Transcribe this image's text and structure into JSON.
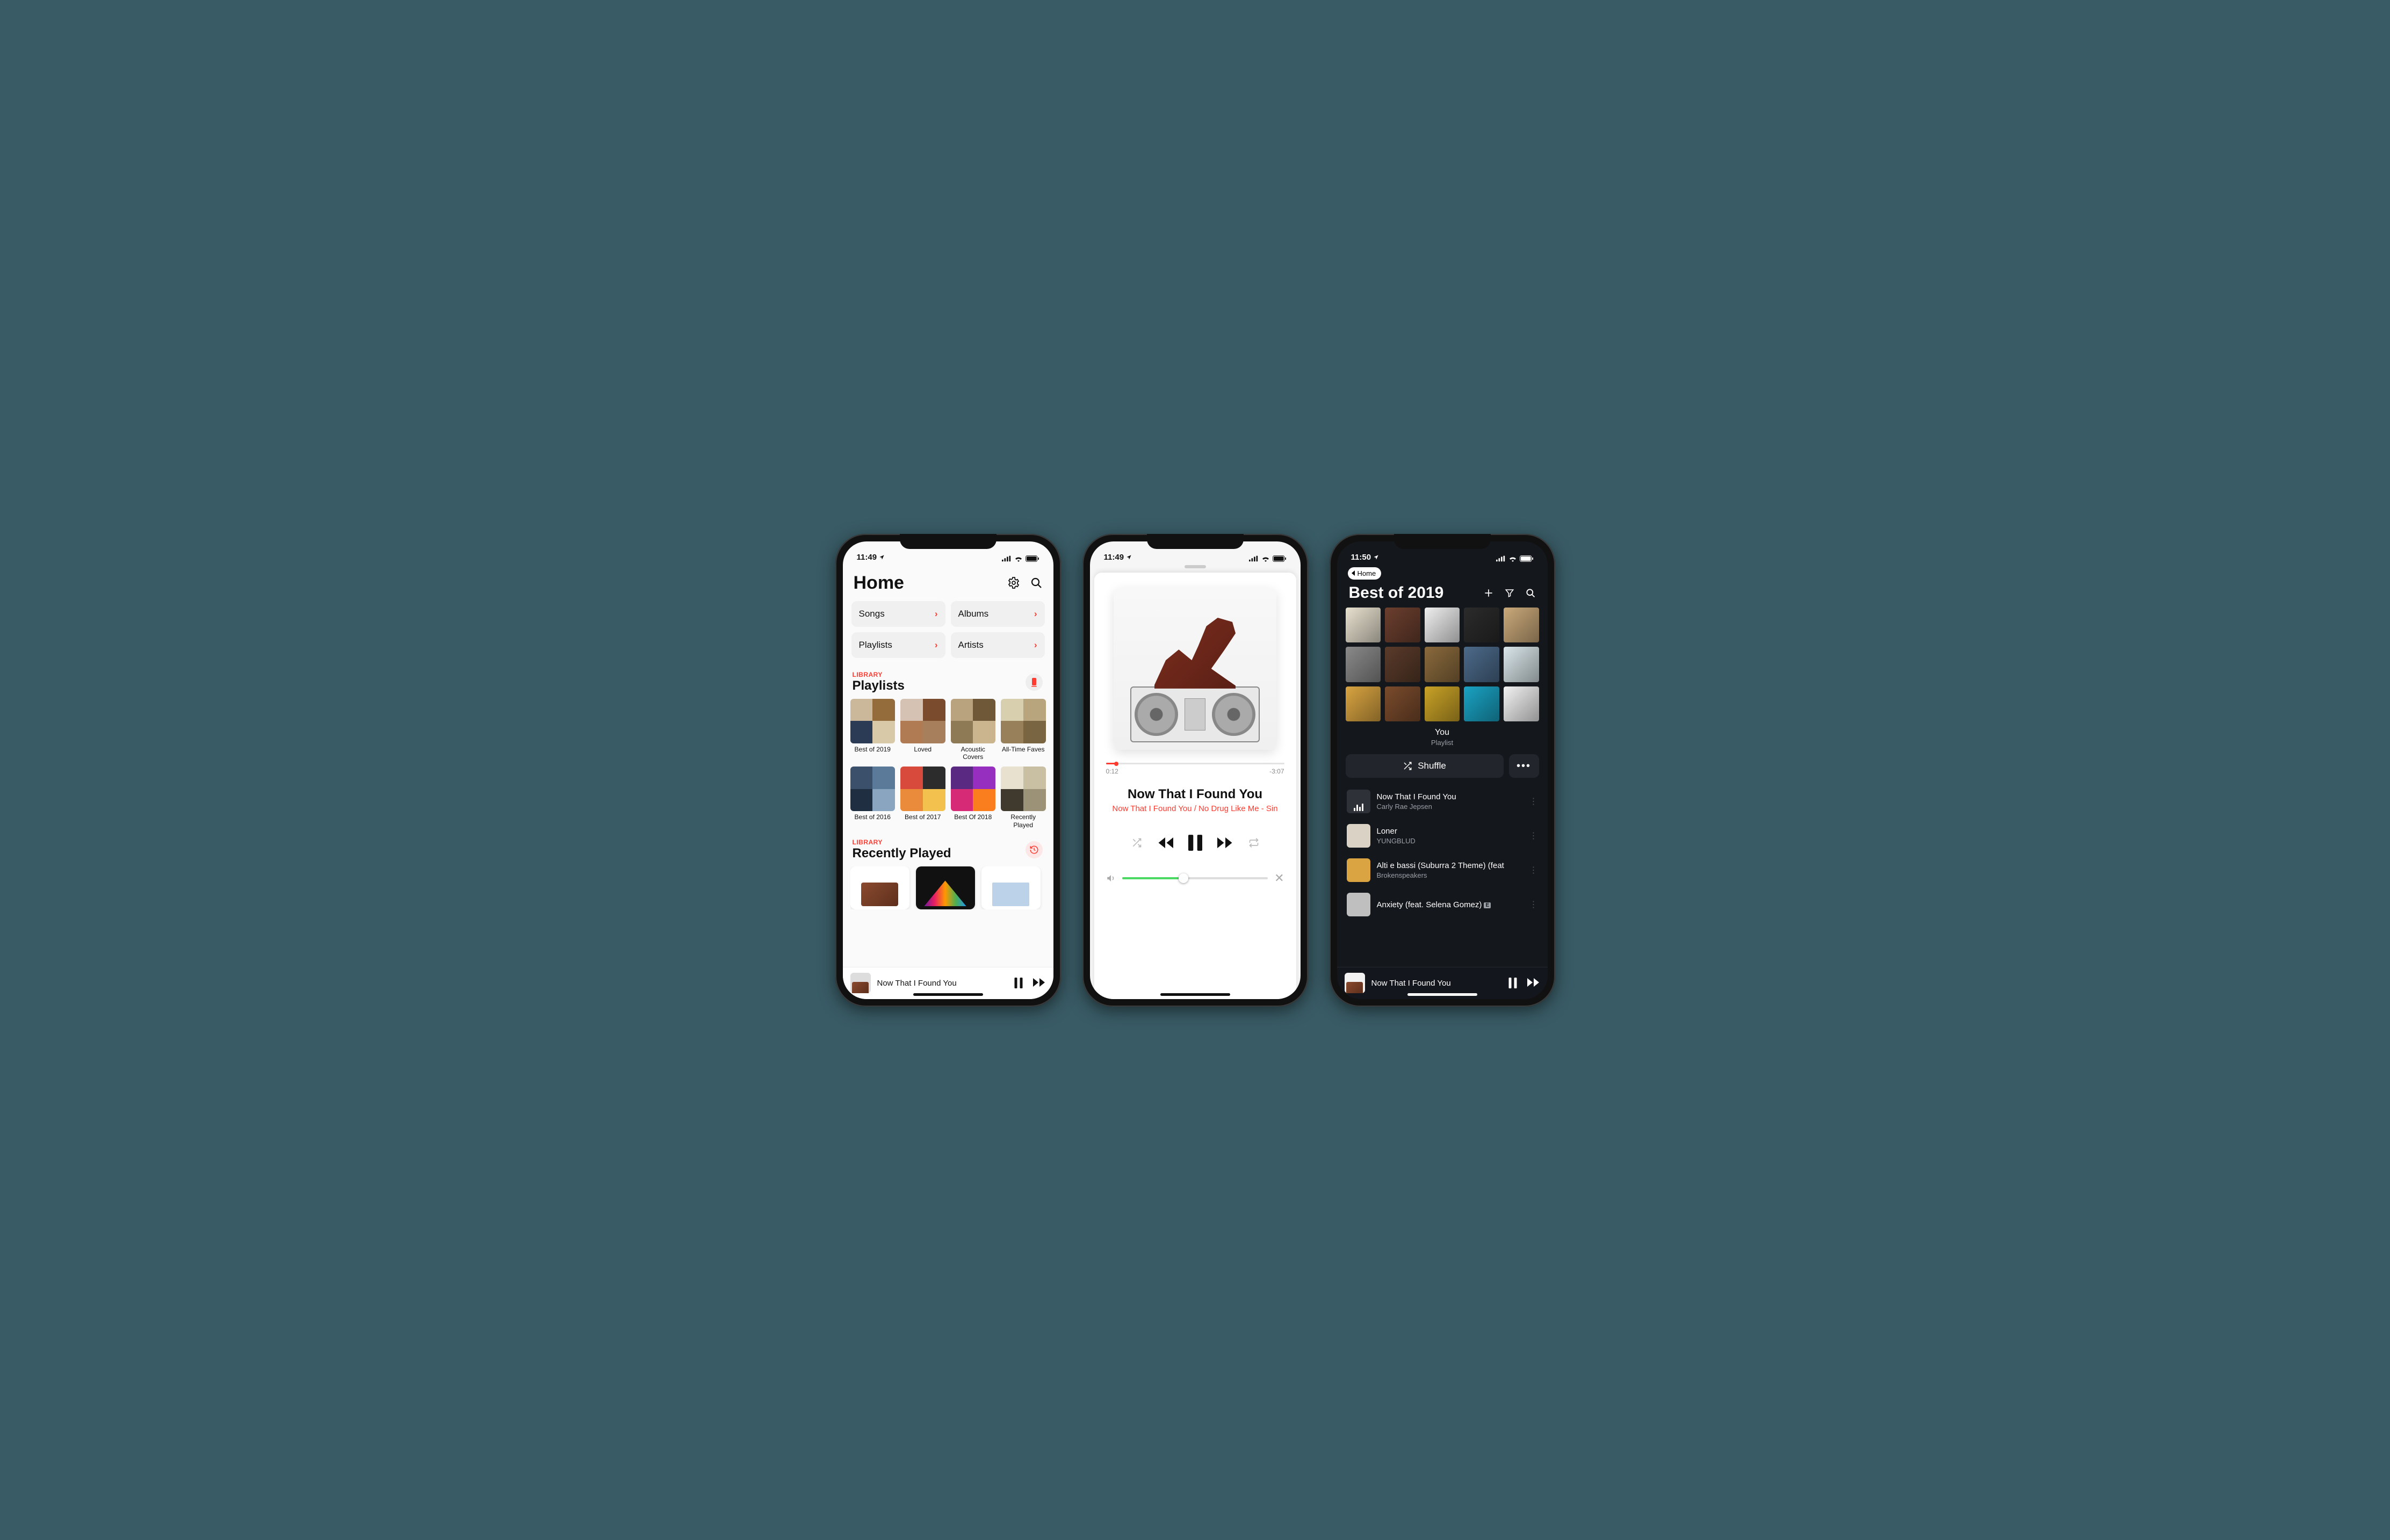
{
  "phone1": {
    "statusTime": "11:49",
    "headerTitle": "Home",
    "categories": [
      "Songs",
      "Albums",
      "Playlists",
      "Artists"
    ],
    "library": {
      "label": "LIBRARY",
      "title": "Playlists",
      "items": [
        "Best of 2019",
        "Loved",
        "Acoustic Covers",
        "All-Time Faves",
        "Best of 2016",
        "Best of 2017",
        "Best Of 2018",
        "Recently Played"
      ]
    },
    "recent": {
      "label": "LIBRARY",
      "title": "Recently Played"
    },
    "miniPlayer": {
      "title": "Now That I Found You"
    }
  },
  "phone2": {
    "statusTime": "11:49",
    "elapsed": "0:12",
    "remaining": "-3:07",
    "track": "Now That I Found You",
    "album": "Now That I Found You / No Drug Like Me - Sin"
  },
  "phone3": {
    "statusTime": "11:50",
    "backLabel": "Home",
    "title": "Best of 2019",
    "subtitle1": "You",
    "subtitle2": "Playlist",
    "shuffle": "Shuffle",
    "tracks": [
      {
        "title": "Now That I Found You",
        "artist": "Carly Rae Jepsen",
        "playing": true,
        "explicit": false
      },
      {
        "title": "Loner",
        "artist": "YUNGBLUD",
        "playing": false,
        "explicit": false
      },
      {
        "title": "Alti e bassi (Suburra 2 Theme) (feat",
        "artist": "Brokenspeakers",
        "playing": false,
        "explicit": false
      },
      {
        "title": "Anxiety (feat. Selena Gomez)",
        "artist": "",
        "playing": false,
        "explicit": true
      }
    ],
    "miniPlayer": {
      "title": "Now That I Found You"
    }
  },
  "palettes": [
    [
      "#cbb89a",
      "#946b3b",
      "#2b3a55",
      "#d8c9a8"
    ],
    [
      "#d5c2b2",
      "#7a4b2c",
      "#b07b53",
      "#a87f5c"
    ],
    [
      "#b9a27e",
      "#6f5838",
      "#8f7a56",
      "#cab58f"
    ],
    [
      "#d7cfae",
      "#b8a57d",
      "#98815a",
      "#7a6542"
    ],
    [
      "#3a506b",
      "#5b7a99",
      "#1f2e40",
      "#8aa5bf"
    ],
    [
      "#d84a3c",
      "#2c2c2c",
      "#e98b3a",
      "#f2c14e"
    ],
    [
      "#5a2a82",
      "#962fbf",
      "#d62976",
      "#fa7e1e"
    ],
    [
      "#e8e1cf",
      "#c9bfa3",
      "#403a2e",
      "#9c9277"
    ]
  ],
  "darkAlbums": [
    "#e8e1cf",
    "#6b3f2e",
    "#efefef",
    "#2b2b2b",
    "#caa97a",
    "#8a8a8a",
    "#5a3b2a",
    "#8a6a3d",
    "#4c6a8a",
    "#d9e6ea",
    "#d9a441",
    "#7a4b2c",
    "#c9a227",
    "#1aa3c4",
    "#f2f2f2"
  ]
}
